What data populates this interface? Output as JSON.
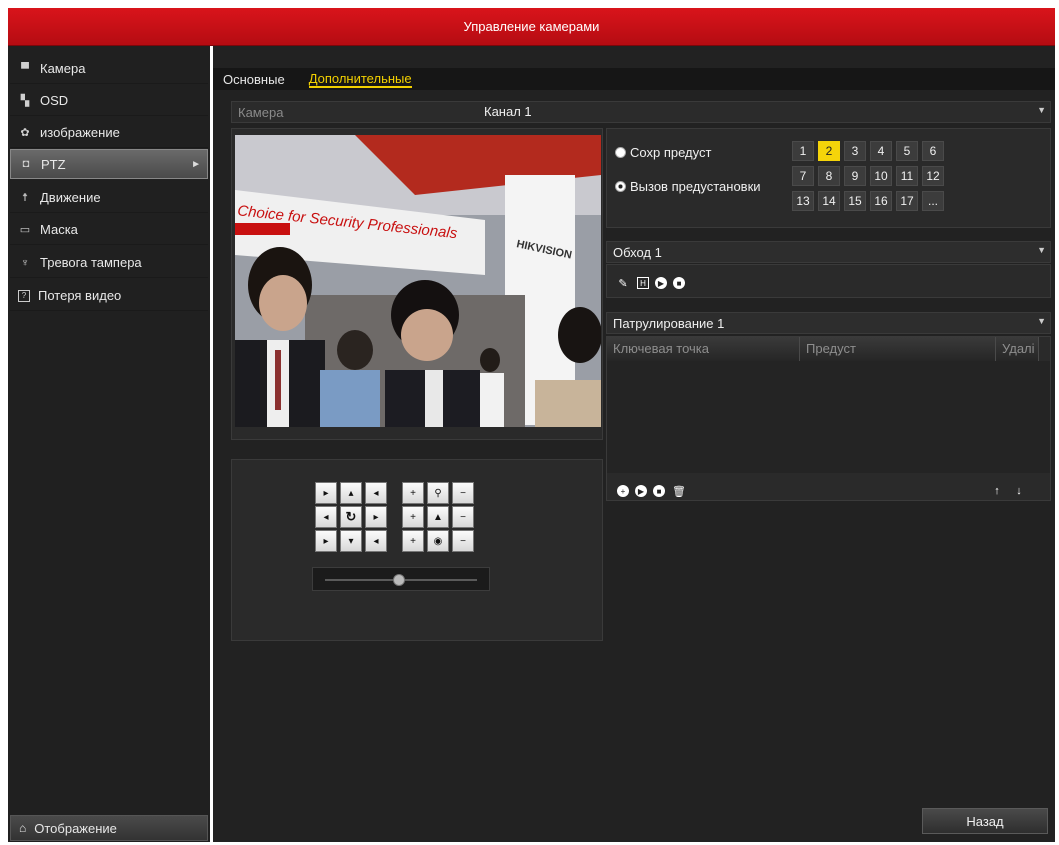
{
  "window": {
    "title": "Управление камерами"
  },
  "sidebar": {
    "items": [
      {
        "label": "Камера",
        "icon": "camera-icon"
      },
      {
        "label": "OSD",
        "icon": "osd-icon"
      },
      {
        "label": "изображение",
        "icon": "image-icon"
      },
      {
        "label": "PTZ",
        "icon": "ptz-icon",
        "active": true
      },
      {
        "label": "Движение",
        "icon": "motion-icon"
      },
      {
        "label": "Маска",
        "icon": "mask-icon"
      },
      {
        "label": "Тревога тампера",
        "icon": "tamper-icon"
      },
      {
        "label": "Потеря видео",
        "icon": "video-loss-icon"
      }
    ],
    "bottom": {
      "label": "Отображение",
      "icon": "home-icon"
    }
  },
  "tabs": [
    {
      "label": "Основные",
      "active": false
    },
    {
      "label": "Дополнительные",
      "active": true
    }
  ],
  "camera": {
    "label": "Камера",
    "value": "Канал 1"
  },
  "preset": {
    "save_label": "Сохр предуст",
    "call_label": "Вызов предустановки",
    "numbers": [
      "1",
      "2",
      "3",
      "4",
      "5",
      "6",
      "7",
      "8",
      "9",
      "10",
      "11",
      "12",
      "13",
      "14",
      "15",
      "16",
      "17",
      "..."
    ],
    "selected": "2"
  },
  "patrol": {
    "value": "Обход 1"
  },
  "pattern": {
    "value": "Патрулирование 1"
  },
  "keypoint_table": {
    "columns": [
      "Ключевая точка",
      "Предуст",
      "Удалі"
    ]
  },
  "buttons": {
    "back": "Назад"
  },
  "colors": {
    "accent": "#f5d40a",
    "titlebar": "#c8101a"
  },
  "video": {
    "banner_text": "Choice for Security Professionals",
    "logo_text": "HIKVISION"
  }
}
